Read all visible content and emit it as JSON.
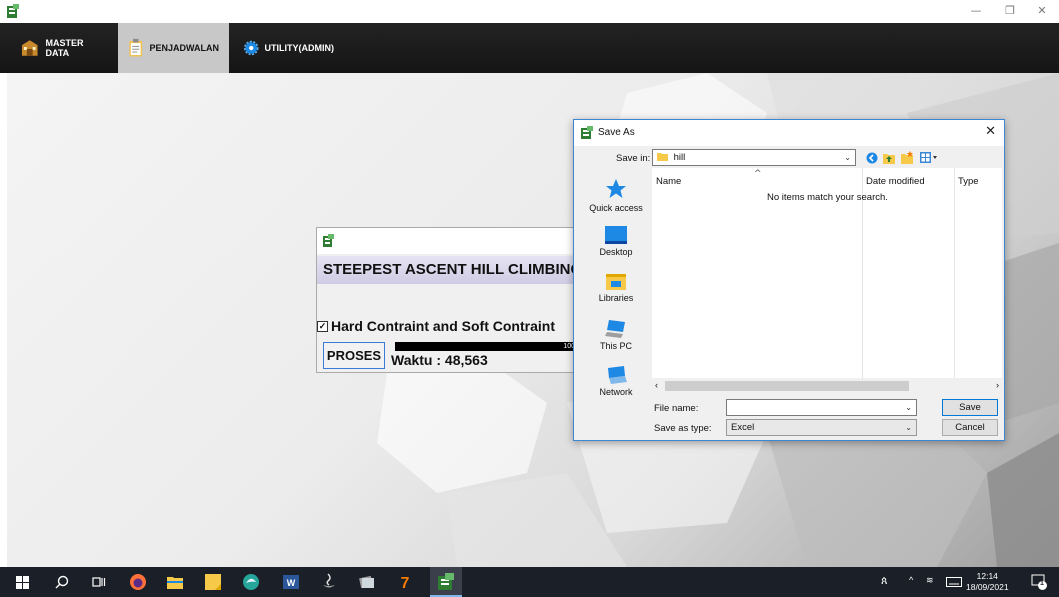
{
  "menubar": {
    "items": [
      {
        "label": "MASTER DATA",
        "icon": "building-icon"
      },
      {
        "label": "PENJADWALAN",
        "icon": "clipboard-icon"
      },
      {
        "label": "UTILITY(ADMIN)",
        "icon": "gear-icon"
      }
    ]
  },
  "internal_frame": {
    "heading": "STEEPEST ASCENT HILL CLIMBING",
    "checkbox_label": "Hard Contraint and Soft Contraint",
    "checkbox_checked": true,
    "proses_label": "PROSES",
    "progress_text": "100",
    "progress_value": 100,
    "waktu_text": "Waktu : 48,563"
  },
  "dialog": {
    "title": "Save As",
    "save_in_label": "Save in:",
    "save_in_value": "hill",
    "places": [
      "Quick access",
      "Desktop",
      "Libraries",
      "This PC",
      "Network"
    ],
    "columns": [
      "Name",
      "Date modified",
      "Type"
    ],
    "empty_message": "No items match your search.",
    "file_name_label": "File name:",
    "file_name_value": "",
    "save_as_type_label": "Save as type:",
    "save_as_type_value": "Excel",
    "save_button": "Save",
    "cancel_button": "Cancel"
  },
  "taskbar": {
    "time": "12:14",
    "date": "18/09/2021",
    "notification_count": "1"
  },
  "colors": {
    "menubar_bg": "#1b1b1b",
    "active_tab": "#c8c8c8",
    "dialog_border": "#3a87d6",
    "taskbar_bg": "#1b1f27"
  }
}
